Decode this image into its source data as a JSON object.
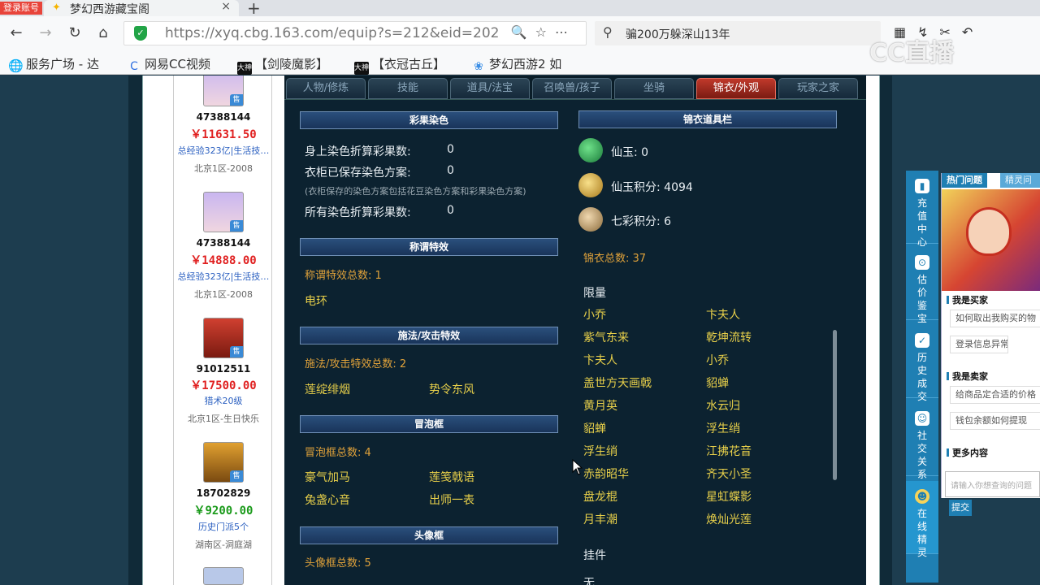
{
  "browser": {
    "login_badge": "登录账号",
    "tab_title": "梦幻西游藏宝阁",
    "tab_close": "×",
    "new_tab": "+",
    "url": "https://xyq.cbg.163.com/equip?s=212&eid=202",
    "search_text": "骗200万躲深山13年",
    "bookmarks": [
      "服务广场 - 达",
      "网易CC视频",
      "【剑陵魔影】",
      "【衣冠古丘】",
      "梦幻西游2 如"
    ],
    "bookmark_badge": "大神",
    "watermark": "CC直播"
  },
  "listing": [
    {
      "id": "47388144",
      "price": "￥11631.50",
      "price_color": "#e02020",
      "desc": "总经验323亿|生活技…",
      "server": "北京1区-2008",
      "badge": "售"
    },
    {
      "id": "47388144",
      "price": "￥14888.00",
      "price_color": "#e02020",
      "desc": "总经验323亿|生活技…",
      "server": "北京1区-2008",
      "badge": "售"
    },
    {
      "id": "91012511",
      "price": "￥17500.00",
      "price_color": "#e02020",
      "desc": "猎术20级",
      "server": "北京1区-生日快乐",
      "badge": "售"
    },
    {
      "id": "18702829",
      "price": "￥9200.00",
      "price_color": "#1a9a1a",
      "desc": "历史门派5个",
      "server": "湖南区-洞庭湖",
      "badge": "售"
    }
  ],
  "tabs": [
    "人物/修炼",
    "技能",
    "道具/法宝",
    "召唤兽/孩子",
    "坐骑",
    "锦衣/外观",
    "玩家之家"
  ],
  "left_sections": {
    "dye": {
      "title": "彩果染色",
      "rows": [
        {
          "label": "身上染色折算彩果数:",
          "value": "0"
        },
        {
          "label": "衣柜已保存染色方案:",
          "value": "0"
        },
        {
          "label": "所有染色折算彩果数:",
          "value": "0"
        }
      ],
      "note": "(衣柜保存的染色方案包括花豆染色方案和彩果染色方案)"
    },
    "title_effect": {
      "title": "称谓特效",
      "count": "称谓特效总数: 1",
      "items": [
        "电环"
      ]
    },
    "cast_effect": {
      "title": "施法/攻击特效",
      "count": "施法/攻击特效总数: 2",
      "items": [
        "莲绽绯烟",
        "势令东风"
      ]
    },
    "bubble": {
      "title": "冒泡框",
      "count": "冒泡框总数: 4",
      "items": [
        "豪气加马",
        "莲笺戟语",
        "兔盏心音",
        "出师一表"
      ]
    },
    "avatar_frame": {
      "title": "头像框",
      "count": "头像框总数: 5"
    }
  },
  "right_section": {
    "title": "锦衣道具栏",
    "props": [
      {
        "label": "仙玉: 0",
        "icon": "jade-icon",
        "color": "#2fae4e"
      },
      {
        "label": "仙玉积分: 4094",
        "icon": "jade-points-icon",
        "color": "#d8a83a"
      },
      {
        "label": "七彩积分: 6",
        "icon": "rainbow-points-icon",
        "color": "#c9a46a"
      }
    ],
    "outfit_total": "锦衣总数: 37",
    "limited_label": "限量",
    "limited_items": [
      [
        "小乔",
        "卞夫人"
      ],
      [
        "紫气东来",
        "乾坤流转"
      ],
      [
        "卞夫人",
        "小乔"
      ],
      [
        "盖世方天画戟",
        "貂蝉"
      ],
      [
        "黄月英",
        "水云归"
      ],
      [
        "貂蝉",
        "浮生绡"
      ],
      [
        "浮生绡",
        "江拂花音"
      ],
      [
        "赤韵昭华",
        "齐天小圣"
      ],
      [
        "盘龙棍",
        "星虹蝶影"
      ],
      [
        "月丰潮",
        "焕灿光莲"
      ]
    ],
    "pendant_label": "挂件",
    "pendant_value": "无"
  },
  "service": [
    {
      "icon": "recharge-icon",
      "label": "充值中心"
    },
    {
      "icon": "appraise-icon",
      "label": "估价鉴宝"
    },
    {
      "icon": "history-icon",
      "label": "历史成交"
    },
    {
      "icon": "social-icon",
      "label": "社交关系"
    },
    {
      "icon": "sprite-icon",
      "label": "在线精灵"
    }
  ],
  "help": {
    "tab_hot": "热门问题",
    "tab_sprite": "精灵问答",
    "buyer_title": "我是买家",
    "buyer_q1": "如何取出我购买的物",
    "buyer_q2": "登录信息异常",
    "seller_title": "我是卖家",
    "seller_q1": "给商品定合适的价格",
    "seller_q2": "钱包余额如何提现",
    "more": "更多内容",
    "input_placeholder": "请输入你想查询的问题",
    "submit": "提交"
  }
}
